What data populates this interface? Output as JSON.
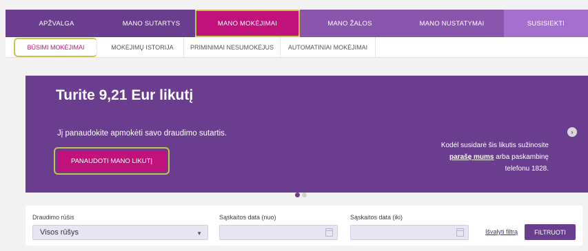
{
  "top_nav": {
    "items": [
      {
        "label": "APŽVALGA"
      },
      {
        "label": "MANO SUTARTYS"
      },
      {
        "label": "MANO MOKĖJIMAI"
      },
      {
        "label": "MANO ŽALOS"
      },
      {
        "label": "MANO NUSTATYMAI"
      },
      {
        "label": "SUSISIEKTI"
      }
    ],
    "colors": {
      "primary": "#6a3d8f",
      "active": "#c0127a",
      "mid": "#8a56ad",
      "light": "#a56fcf"
    }
  },
  "sub_nav": {
    "items": [
      {
        "label": "BŪSIMI MOKĖJIMAI"
      },
      {
        "label": "MOKĖJIMŲ ISTORIJA"
      },
      {
        "label": "PRIMINIMAI NESUMOKĖJUS"
      },
      {
        "label": "AUTOMATINIAI MOKĖJIMAI"
      }
    ]
  },
  "hero": {
    "title": "Turite 9,21 Eur likutį",
    "subtitle": "Jį panaudokite apmokėti savo draudimo sutartis.",
    "button": "PANAUDOTI MANO LIKUTĮ",
    "info_line1": "Kodėl susidarė šis likutis sužinosite",
    "info_link": "parašę mums",
    "info_line2_tail": " arba paskambinę",
    "info_line3": "telefonu 1828.",
    "arrow_icon": "chevron-right-icon"
  },
  "filters": {
    "type_label": "Draudimo rūšis",
    "type_value": "Visos rūšys",
    "date_from_label": "Sąskaitos data (nuo)",
    "date_to_label": "Sąskaitos data (iki)",
    "reset_label": "Išvalyti filtrą",
    "submit_label": "FILTRUOTI"
  }
}
